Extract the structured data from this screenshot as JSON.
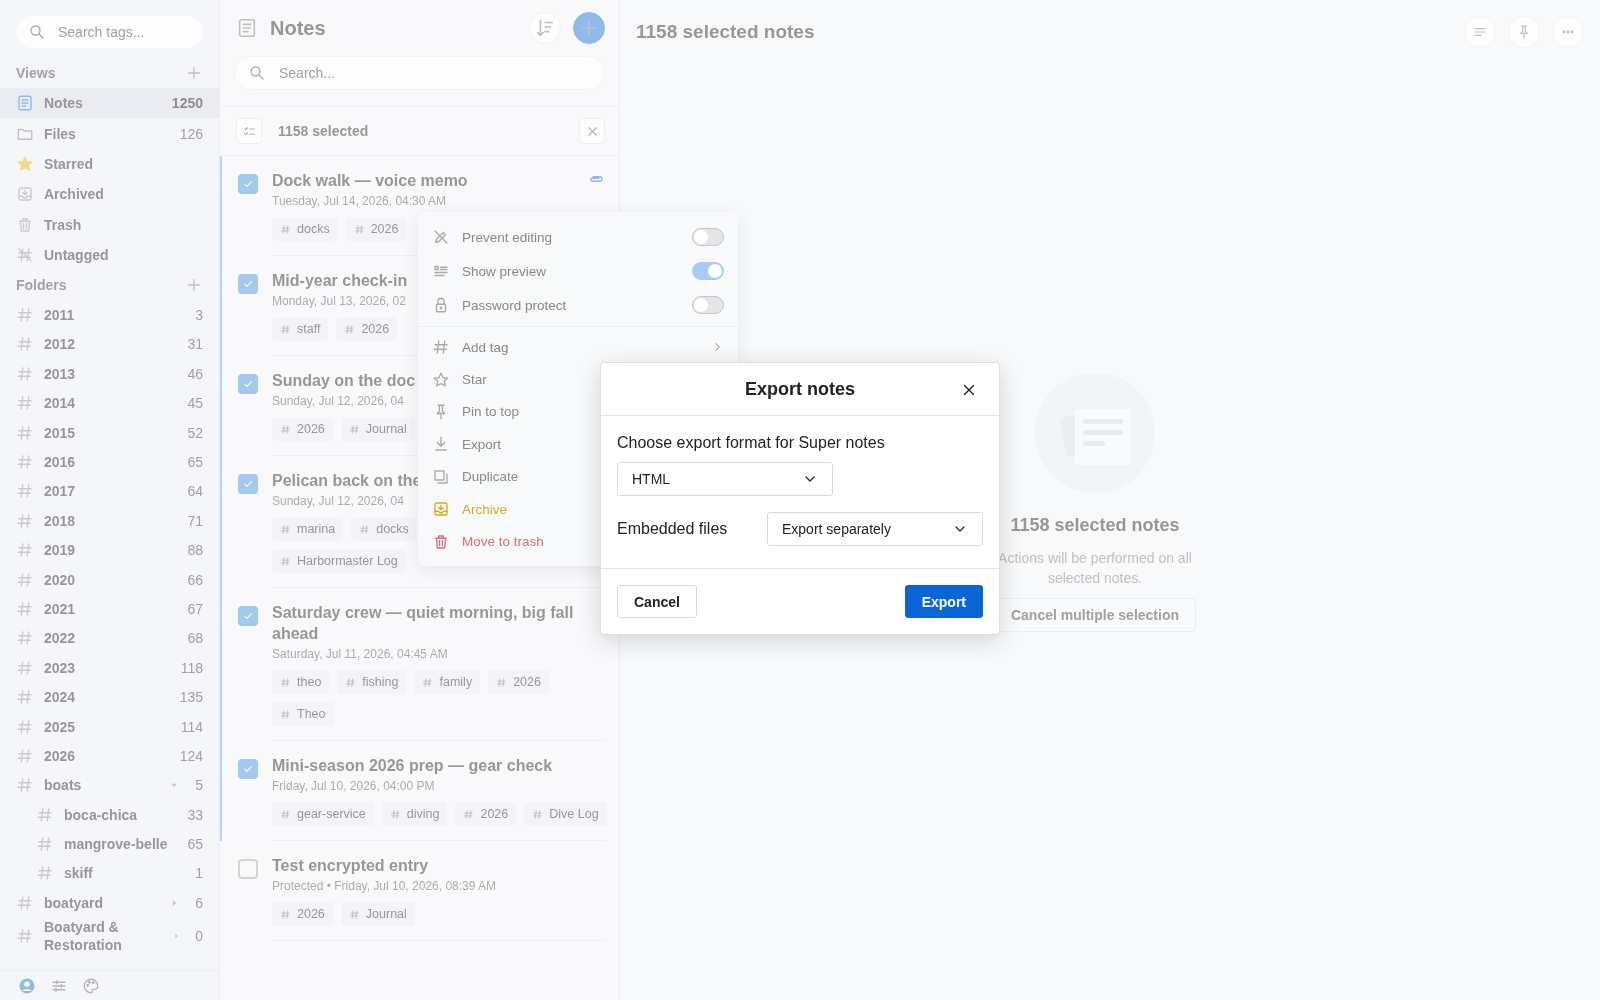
{
  "sidebar": {
    "search": {
      "placeholder": "Search tags..."
    },
    "views": {
      "title": "Views",
      "items": [
        {
          "label": "Notes",
          "count": "1250",
          "selected": true
        },
        {
          "label": "Files",
          "count": "126",
          "selected": false
        },
        {
          "label": "Starred",
          "selected": false
        },
        {
          "label": "Archived",
          "selected": false
        },
        {
          "label": "Trash",
          "selected": false
        },
        {
          "label": "Untagged",
          "selected": false
        }
      ]
    },
    "folders": {
      "title": "Folders",
      "items": [
        {
          "label": "2011",
          "count": "3"
        },
        {
          "label": "2012",
          "count": "31"
        },
        {
          "label": "2013",
          "count": "46"
        },
        {
          "label": "2014",
          "count": "45"
        },
        {
          "label": "2015",
          "count": "52"
        },
        {
          "label": "2016",
          "count": "65"
        },
        {
          "label": "2017",
          "count": "64"
        },
        {
          "label": "2018",
          "count": "71"
        },
        {
          "label": "2019",
          "count": "88"
        },
        {
          "label": "2020",
          "count": "66"
        },
        {
          "label": "2021",
          "count": "67"
        },
        {
          "label": "2022",
          "count": "68"
        },
        {
          "label": "2023",
          "count": "118"
        },
        {
          "label": "2024",
          "count": "135"
        },
        {
          "label": "2025",
          "count": "114"
        },
        {
          "label": "2026",
          "count": "124"
        },
        {
          "label": "boats",
          "count": "5",
          "expanded": true,
          "children": [
            {
              "label": "boca-chica",
              "count": "33"
            },
            {
              "label": "mangrove-belle",
              "count": "65"
            },
            {
              "label": "skiff",
              "count": "1"
            }
          ]
        },
        {
          "label": "boatyard",
          "count": "6",
          "expanded": false
        },
        {
          "label": "Boatyard & Restoration",
          "count": "0",
          "expanded": false
        }
      ]
    }
  },
  "notes": {
    "title": "Notes",
    "search": {
      "placeholder": "Search..."
    },
    "selection": {
      "label": "1158 selected"
    },
    "items": [
      {
        "title": "Dock walk — voice memo",
        "date": "Tuesday, Jul 14, 2026, 04:30 AM",
        "tag_lines": [
          [
            "docks",
            "2026"
          ]
        ],
        "checked": true,
        "attachment": true
      },
      {
        "title": "Mid-year check-in",
        "date": "Monday, Jul 13, 2026, 02",
        "tag_lines": [
          [
            "staff",
            "2026"
          ]
        ],
        "checked": true,
        "attachment": false
      },
      {
        "title": "Sunday on the doc",
        "date": "Sunday, Jul 12, 2026, 04",
        "tag_lines": [
          [
            "2026",
            "Journal"
          ]
        ],
        "checked": true,
        "attachment": false
      },
      {
        "title": "Pelican back on the",
        "date": "Sunday, Jul 12, 2026, 04",
        "tag_lines": [
          [
            "marina",
            "docks"
          ],
          [
            "Harbormaster Log"
          ]
        ],
        "checked": true,
        "attachment": false
      },
      {
        "title": "Saturday crew — quiet morning, big fall ahead",
        "date": "Saturday, Jul 11, 2026, 04:45 AM",
        "tag_lines": [
          [
            "theo",
            "fishing",
            "family",
            "2026"
          ],
          [
            "Theo"
          ]
        ],
        "checked": true,
        "attachment": false
      },
      {
        "title": "Mini-season 2026 prep — gear check",
        "date": "Friday, Jul 10, 2026, 04:00 PM",
        "tag_lines": [
          [
            "gear-service",
            "diving",
            "2026",
            "Dive Log"
          ]
        ],
        "checked": true,
        "attachment": false
      },
      {
        "title": "Test encrypted entry",
        "date": "Protected • Friday, Jul 10, 2026, 08:39 AM",
        "tag_lines": [
          [
            "2026",
            "Journal"
          ]
        ],
        "checked": false,
        "attachment": false
      }
    ]
  },
  "context_menu": {
    "sections": [
      {
        "items": [
          {
            "kind": "toggle",
            "label": "Prevent editing",
            "on": false
          },
          {
            "kind": "toggle",
            "label": "Show preview",
            "on": true
          },
          {
            "kind": "toggle",
            "label": "Password protect",
            "on": false
          }
        ]
      },
      {
        "items": [
          {
            "kind": "submenu",
            "label": "Add tag"
          },
          {
            "kind": "action",
            "label": "Star"
          },
          {
            "kind": "action",
            "label": "Pin to top"
          },
          {
            "kind": "action",
            "label": "Export"
          },
          {
            "kind": "action",
            "label": "Duplicate"
          },
          {
            "kind": "action",
            "label": "Archive",
            "color": "#d6ac1e"
          },
          {
            "kind": "action",
            "label": "Move to trash",
            "color": "#dc6f6f"
          }
        ]
      }
    ]
  },
  "editor": {
    "title": "1158 selected notes",
    "empty": {
      "title": "1158 selected notes",
      "text": "Actions will be performed on all selected notes.",
      "button": "Cancel multiple selection"
    }
  },
  "export_dialog": {
    "title": "Export notes",
    "format_label": "Choose export format for Super notes",
    "format": {
      "value": "HTML"
    },
    "embedded_label": "Embedded files",
    "embedded": {
      "value": "Export separately"
    },
    "buttons": [
      {
        "label": "Cancel",
        "kind": "secondary"
      },
      {
        "label": "Export",
        "kind": "primary"
      }
    ]
  }
}
